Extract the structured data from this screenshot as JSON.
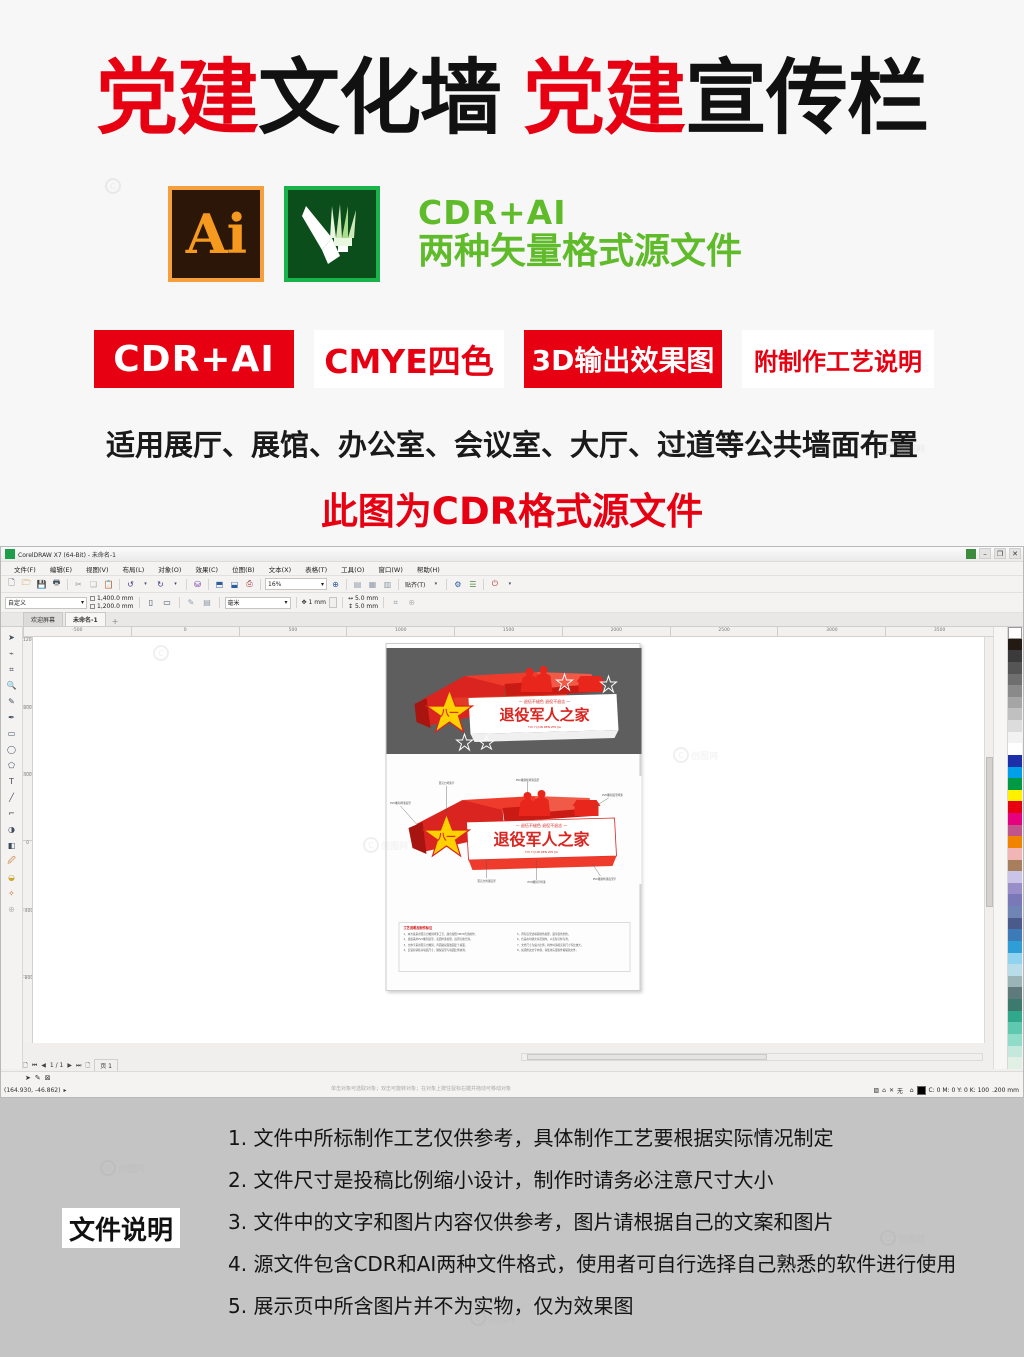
{
  "promo": {
    "headline_parts": [
      {
        "text": "党建",
        "color": "red"
      },
      {
        "text": "文化墙",
        "color": "black"
      },
      {
        "text": "党建",
        "color": "red"
      },
      {
        "text": "宣传栏",
        "color": "black"
      }
    ],
    "ai_logo_label": "Ai",
    "cdr_logo_label": "CorelDRAW",
    "format_line1": "CDR+AI",
    "format_line2": "两种矢量格式源文件",
    "badges": [
      {
        "label": "CDR+AI",
        "style": "fill"
      },
      {
        "label": "CMYE四色",
        "style": "ghost"
      },
      {
        "label": "3D输出效果图",
        "style": "fill"
      },
      {
        "label": "附制作工艺说明",
        "style": "ghost"
      }
    ],
    "subline": "适用展厅、展馆、办公室、会议室、大厅、过道等公共墙面布置",
    "cdr_note": "此图为CDR格式源文件",
    "accent_red": "#e60012",
    "accent_green": "#5fbb2a"
  },
  "app": {
    "title": "CorelDRAW X7 (64-Bit) - 未命名-1",
    "window_buttons": [
      "–",
      "❐",
      "✕"
    ],
    "menus": [
      "文件(F)",
      "编辑(E)",
      "视图(V)",
      "布局(L)",
      "对象(O)",
      "效果(C)",
      "位图(B)",
      "文本(X)",
      "表格(T)",
      "工具(O)",
      "窗口(W)",
      "帮助(H)"
    ],
    "toolbar": {
      "zoom_value": "16%",
      "snap_label": "贴齐(T)",
      "icons": [
        "new-icon",
        "open-icon",
        "save-icon",
        "print-icon",
        "cut-icon",
        "copy-icon",
        "paste-icon",
        "undo-icon",
        "redo-icon",
        "import-icon",
        "export-icon",
        "publish-pdf-icon",
        "application-launcher-icon",
        "welcome-screen-icon"
      ]
    },
    "property_bar": {
      "page_preset": "自定义",
      "page_width": "1,400.0 mm",
      "page_height": "1,200.0 mm",
      "units": "毫米",
      "nudge": "1 mm",
      "bleed_h": "5.0 mm",
      "bleed_v": "5.0 mm"
    },
    "doc_tabs": [
      {
        "label": "欢迎屏幕",
        "active": false
      },
      {
        "label": "未命名-1",
        "active": true
      }
    ],
    "tab_add_label": "+",
    "ruler_h_ticks": [
      "-500",
      "0",
      "500",
      "1000",
      "1500",
      "2000",
      "2500",
      "3000",
      "3500"
    ],
    "ruler_v_ticks": [
      "1200",
      "800",
      "400",
      "0",
      "-400",
      "-800"
    ],
    "toolbox": [
      "pick-tool-icon",
      "shape-tool-icon",
      "crop-tool-icon",
      "zoom-tool-icon",
      "freehand-tool-icon",
      "smart-fill-icon",
      "rectangle-tool-icon",
      "ellipse-tool-icon",
      "polygon-tool-icon",
      "text-tool-icon",
      "parallel-dimension-icon",
      "straight-line-connector-icon",
      "drop-shadow-icon",
      "transparency-tool-icon",
      "color-eyedropper-icon",
      "interactive-fill-icon",
      "smart-drawing-icon",
      "add-tool-icon"
    ],
    "statusbar": {
      "coordinates": "(164.930, -46.862)",
      "page_indicator": "1 / 1",
      "page_tab": "页 1",
      "hint": "单击对象可选取对象；双击可旋转对象；在对象上按住鼠标右键并拖动可移动对象",
      "fill_label": "无",
      "outline_color": "C: 0 M: 0 Y: 0 K: 100",
      "outline_width": ".200 mm"
    },
    "artwork": {
      "title": "退役军人之家",
      "slogan_top": "退伍不褪色  退役不退志",
      "subtitle_en": "TUI YI JUN REN ZHI JIA",
      "process_note_title": "工艺说明及制作标注",
      "callouts": [
        "亚克力雕刻烤漆造型",
        "PVC雕刻字烤漆",
        "亚克力烤漆字",
        "PVC雕刻板烤漆造型",
        "PVC雕刻造型烤漆",
        "亚克力烤漆造型",
        "PVC雕刻烤漆造型字"
      ]
    }
  },
  "notes": {
    "label": "文件说明",
    "items": [
      "1. 文件中所标制作工艺仅供参考，具体制作工艺要根据实际情况制定",
      "2. 文件尺寸是投稿比例缩小设计，制作时请务必注意尺寸大小",
      "3. 文件中的文字和图片内容仅供参考，图片请根据自己的文案和图片",
      "4. 源文件包含CDR和AI两种文件格式，使用者可自行选择自己熟悉的软件进行使用",
      "5. 展示页中所含图片并不为实物，仅为效果图"
    ],
    "background": "#c4c4c4"
  },
  "watermark": {
    "text": "创图网"
  }
}
